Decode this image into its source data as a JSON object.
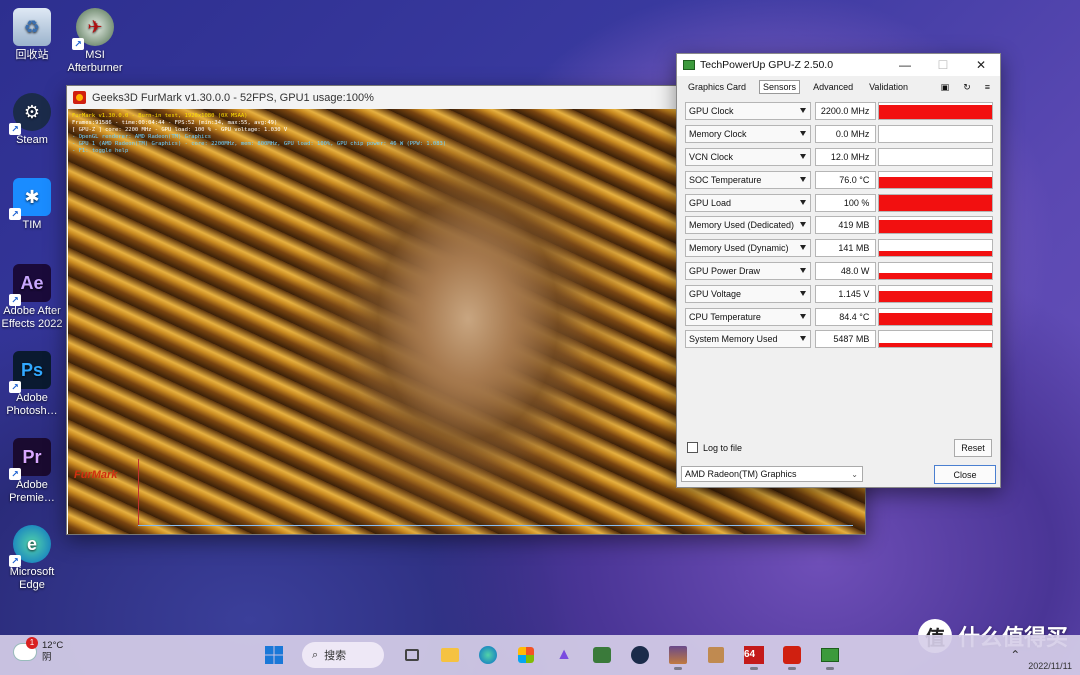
{
  "desktop": {
    "icons": [
      {
        "label": "回收站",
        "icon": "recycle-bin-icon"
      },
      {
        "label": "MSI Afterburner",
        "icon": "msi-afterburner-icon"
      },
      {
        "label": "Steam",
        "icon": "steam-icon"
      },
      {
        "label": "TIM",
        "icon": "tim-icon"
      },
      {
        "label": "Adobe After Effects 2022",
        "glyph": "Ae"
      },
      {
        "label": "Adobe Photosh…",
        "glyph": "Ps"
      },
      {
        "label": "Adobe Premie…",
        "glyph": "Pr"
      },
      {
        "label": "Microsoft Edge",
        "icon": "edge-icon"
      }
    ]
  },
  "furmark": {
    "title": "Geeks3D FurMark v1.30.0.0 - 52FPS, GPU1 usage:100%",
    "overlay": [
      "FurMark v1.30.0.0 - Burn-in test, 1920x1080 (0X MSAA)",
      "Frames:91586 - time:00:04:44 - FPS:52 (min:34, max:55, avg:49)",
      "[ GPU-Z ] core: 2200 MHz - GPU load: 100 % - GPU voltage: 1.030 V",
      "- OpenGL renderer: AMD Radeon(TM) Graphics",
      "- GPU 1 (AMD Radeon(TM) Graphics) - core: 2200MHz, mem: 800MHz, GPU load: 100%, GPU chip power: 46 W (PPW: 1.083)",
      "- F1: toggle help"
    ],
    "logo": "FurMark"
  },
  "gpuz": {
    "title": "TechPowerUp GPU-Z 2.50.0",
    "tabs": [
      "Graphics Card",
      "Sensors",
      "Advanced",
      "Validation"
    ],
    "active_tab": "Sensors",
    "sensors": [
      {
        "name": "GPU Clock",
        "value": "2200.0 MHz",
        "level": 0.9
      },
      {
        "name": "Memory Clock",
        "value": "0.0 MHz",
        "level": 0
      },
      {
        "name": "VCN Clock",
        "value": "12.0 MHz",
        "level": 0
      },
      {
        "name": "SOC Temperature",
        "value": "76.0 °C",
        "level": 0.65
      },
      {
        "name": "GPU Load",
        "value": "100 %",
        "level": 0.95
      },
      {
        "name": "Memory Used (Dedicated)",
        "value": "419 MB",
        "level": 0.85
      },
      {
        "name": "Memory Used (Dynamic)",
        "value": "141 MB",
        "level": 0.3
      },
      {
        "name": "GPU Power Draw",
        "value": "48.0 W",
        "level": 0.35
      },
      {
        "name": "GPU Voltage",
        "value": "1.145 V",
        "level": 0.7
      },
      {
        "name": "CPU Temperature",
        "value": "84.4 °C",
        "level": 0.75
      },
      {
        "name": "System Memory Used",
        "value": "5487 MB",
        "level": 0.3
      }
    ],
    "log_label": "Log to file",
    "reset_label": "Reset",
    "gpu_select": "AMD Radeon(TM) Graphics",
    "close_label": "Close",
    "graph_color": "#f21010"
  },
  "taskbar": {
    "weather_temp": "12°C",
    "weather_cond": "阴",
    "weather_badge": "1",
    "search_label": "搜索",
    "date": "2022/11/11",
    "watermark": "什么值得买"
  }
}
